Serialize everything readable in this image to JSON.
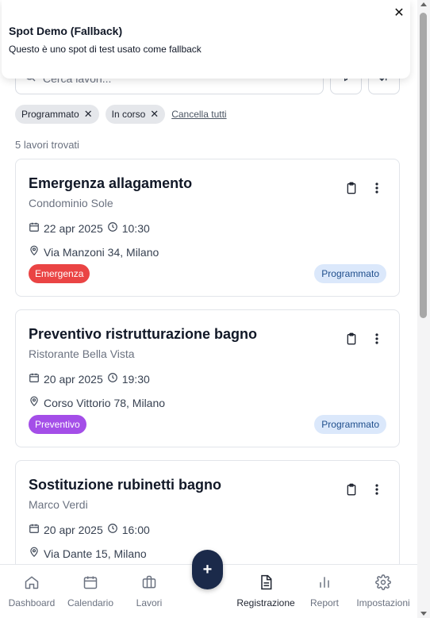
{
  "toast": {
    "title": "Spot Demo (Fallback)",
    "message": "Questo è uno spot di test usato come fallback",
    "close": "✕"
  },
  "search": {
    "placeholder": "Cerca lavori..."
  },
  "filters": {
    "chips": [
      {
        "label": "Programmato",
        "remove": "✕"
      },
      {
        "label": "In corso",
        "remove": "✕"
      }
    ],
    "clear_all": "Cancella tutti"
  },
  "results_count": "5 lavori trovati",
  "jobs": [
    {
      "title": "Emergenza allagamento",
      "client": "Condominio Sole",
      "date": "22 apr 2025",
      "time": "10:30",
      "address": "Via Manzoni 34, Milano",
      "type": "Emergenza",
      "type_color": "#ea4444",
      "status": "Programmato"
    },
    {
      "title": "Preventivo ristrutturazione bagno",
      "client": "Ristorante Bella Vista",
      "date": "20 apr 2025",
      "time": "19:30",
      "address": "Corso Vittorio 78, Milano",
      "type": "Preventivo",
      "type_color": "#a44ee8",
      "status": "Programmato"
    },
    {
      "title": "Sostituzione rubinetti bagno",
      "client": "Marco Verdi",
      "date": "20 apr 2025",
      "time": "16:00",
      "address": "Via Dante 15, Milano"
    }
  ],
  "fab": {
    "label": "+"
  },
  "nav": {
    "dashboard": "Dashboard",
    "calendario": "Calendario",
    "lavori": "Lavori",
    "registrazione": "Registrazione",
    "report": "Report",
    "impostazioni": "Impostazioni"
  },
  "colors": {
    "primary": "#1b2a4a",
    "status_bg": "#dbe8fb",
    "status_text": "#1f4e8c"
  }
}
